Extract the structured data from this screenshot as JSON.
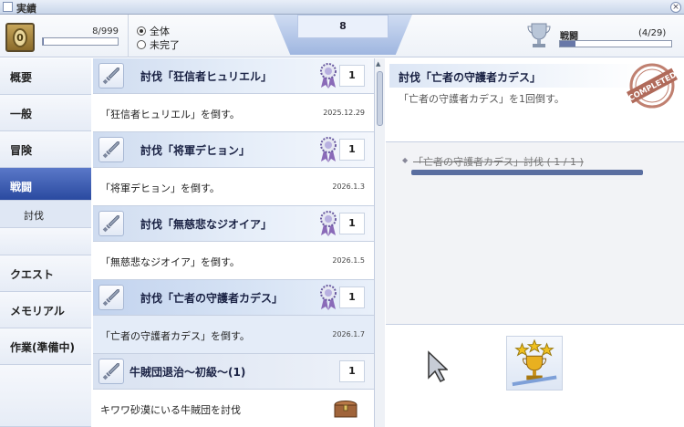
{
  "window": {
    "title": "実績",
    "close_label": "×"
  },
  "header": {
    "points": "8/999",
    "points_fraction": 0.008,
    "filter_all": "全体",
    "filter_incomplete": "未完了",
    "filter_selected": "all",
    "total_count": "8",
    "category_label": "戦闘",
    "category_count": "(4/29)",
    "category_fraction": 0.14,
    "medal_glyph": "0"
  },
  "sidebar": {
    "items": [
      {
        "label": "概要"
      },
      {
        "label": "一般"
      },
      {
        "label": "冒険"
      },
      {
        "label": "戦闘"
      },
      {
        "label": "討伐"
      },
      {
        "label": "クエスト"
      },
      {
        "label": "メモリアル"
      },
      {
        "label": "作業(準備中)"
      }
    ],
    "active_index": 3,
    "active_color": "#2a4aa0"
  },
  "list": {
    "entries": [
      {
        "title": "討伐「狂信者ヒュリエル」",
        "count": "1",
        "description": "「狂信者ヒュリエル」を倒す。",
        "date": "2025.12.29"
      },
      {
        "title": "討伐「将軍デヒョン」",
        "count": "1",
        "description": "「将軍デヒョン」を倒す。",
        "date": "2026.1.3"
      },
      {
        "title": "討伐「無慈悲なジオイア」",
        "count": "1",
        "description": "「無慈悲なジオイア」を倒す。",
        "date": "2026.1.5"
      },
      {
        "title": "討伐「亡者の守護者カデス」",
        "count": "1",
        "description": "「亡者の守護者カデス」を倒す。",
        "date": "2026.1.7"
      },
      {
        "title": "牛賊団退治～初級～(1)",
        "count": "1",
        "description": "キワワ砂漠にいる牛賊団を討伐",
        "date": ""
      }
    ],
    "selected_index": 3
  },
  "detail": {
    "title": "討伐「亡者の守護者カデス」",
    "description": "「亡者の守護者カデス」を1回倒す。",
    "stamp": "COMPLETED",
    "objective": "「亡者の守護者カデス」討伐 ( 1 / 1 )",
    "objective_progress": 1.0
  },
  "icons": {
    "sword": "sword-icon",
    "ribbon": "medal-ribbon-icon",
    "trophy": "trophy-icon",
    "chest": "treasure-chest-icon",
    "reward": "trophy-reward-icon",
    "cursor": "mouse-cursor-icon"
  }
}
